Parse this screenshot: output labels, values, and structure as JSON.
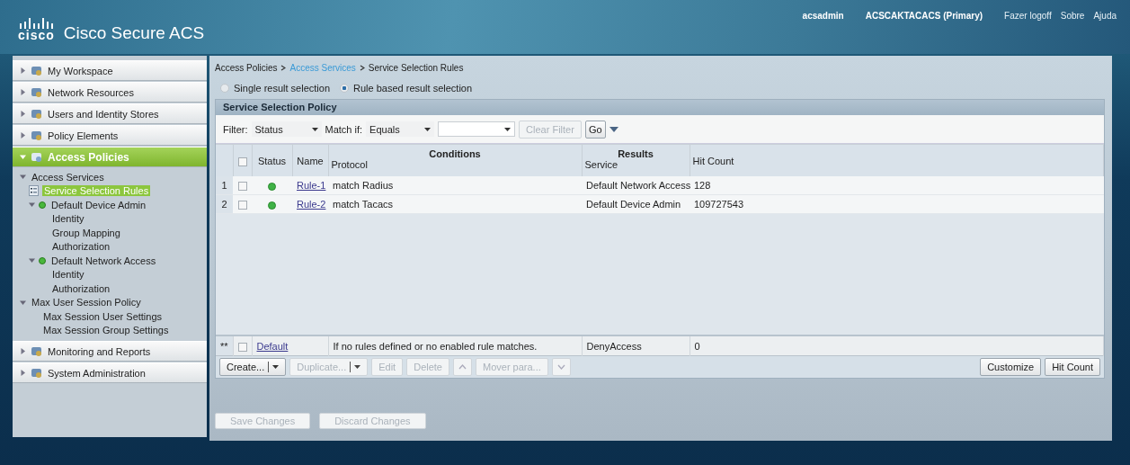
{
  "header": {
    "logo_text": "cisco",
    "product": "Cisco Secure ACS",
    "user": "acsadmin",
    "server": "ACSCAKTACACS (Primary)",
    "links": [
      "Fazer logoff",
      "Sobre",
      "Ajuda"
    ]
  },
  "sidebar": {
    "sections": [
      {
        "label": "My Workspace",
        "expanded": false,
        "selected": false
      },
      {
        "label": "Network Resources",
        "expanded": false,
        "selected": false
      },
      {
        "label": "Users and Identity Stores",
        "expanded": false,
        "selected": false
      },
      {
        "label": "Policy Elements",
        "expanded": false,
        "selected": false
      },
      {
        "label": "Access Policies",
        "expanded": true,
        "selected": true,
        "children": [
          {
            "label": "Access Services",
            "kind": "folder",
            "expanded": true,
            "selected": false,
            "children": [
              {
                "label": "Service Selection Rules",
                "kind": "page",
                "selected": true
              },
              {
                "label": "Default Device Admin",
                "kind": "service",
                "expanded": true,
                "selected": false,
                "children": [
                  {
                    "label": "Identity",
                    "kind": "leaf",
                    "selected": false
                  },
                  {
                    "label": "Group Mapping",
                    "kind": "leaf",
                    "selected": false
                  },
                  {
                    "label": "Authorization",
                    "kind": "leaf",
                    "selected": false
                  }
                ]
              },
              {
                "label": "Default Network Access",
                "kind": "service",
                "expanded": true,
                "selected": false,
                "children": [
                  {
                    "label": "Identity",
                    "kind": "leaf",
                    "selected": false
                  },
                  {
                    "label": "Authorization",
                    "kind": "leaf",
                    "selected": false
                  }
                ]
              }
            ]
          },
          {
            "label": "Max User Session Policy",
            "kind": "folder",
            "expanded": true,
            "selected": false,
            "children": [
              {
                "label": "Max Session User Settings",
                "kind": "leaf",
                "selected": false
              },
              {
                "label": "Max Session Group Settings",
                "kind": "leaf",
                "selected": false
              }
            ]
          }
        ]
      },
      {
        "label": "Monitoring and Reports",
        "expanded": false,
        "selected": false
      },
      {
        "label": "System Administration",
        "expanded": false,
        "selected": false
      }
    ]
  },
  "breadcrumb": [
    {
      "label": "Access Policies",
      "link": false
    },
    {
      "label": "Access Services",
      "link": true
    },
    {
      "label": "Service Selection Rules",
      "link": false
    }
  ],
  "radios": [
    {
      "label": "Single result selection",
      "selected": false
    },
    {
      "label": "Rule based result selection",
      "selected": true
    }
  ],
  "policy": {
    "title": "Service Selection Policy",
    "filter": {
      "label": "Filter:",
      "field": "Status",
      "match_label": "Match if:",
      "match": "Equals",
      "clear": "Clear Filter",
      "go": "Go"
    },
    "table": {
      "select_all": false,
      "headers": {
        "status": "Status",
        "name": "Name",
        "conditions": "Conditions",
        "protocol": "Protocol",
        "results": "Results",
        "service": "Service",
        "hit_count": "Hit Count"
      },
      "rows": [
        {
          "index": "1",
          "checked": false,
          "enabled": true,
          "name": "Rule-1",
          "protocol": "match Radius",
          "service": "Default Network Access",
          "hit_count": "128"
        },
        {
          "index": "2",
          "checked": false,
          "enabled": true,
          "name": "Rule-2",
          "protocol": "match Tacacs",
          "service": "Default Device Admin",
          "hit_count": "109727543"
        }
      ],
      "default_row": {
        "index": "**",
        "checked": false,
        "name": "Default",
        "condition": "If no rules defined or no enabled rule matches.",
        "service": "DenyAccess",
        "hit_count": "0"
      }
    },
    "toolbar": [
      {
        "kind": "split",
        "label": "Create...",
        "disabled": false
      },
      {
        "kind": "split",
        "label": "Duplicate...",
        "disabled": true
      },
      {
        "kind": "plain",
        "label": "Edit",
        "disabled": true
      },
      {
        "kind": "plain",
        "label": "Delete",
        "disabled": true
      },
      {
        "kind": "up",
        "disabled": true
      },
      {
        "kind": "plain",
        "label": "Mover para...",
        "disabled": true
      },
      {
        "kind": "down",
        "disabled": true
      }
    ],
    "right_buttons": [
      "Customize",
      "Hit Count"
    ]
  },
  "footer_buttons": [
    {
      "label": "Save Changes",
      "disabled": true
    },
    {
      "label": "Discard Changes",
      "disabled": true
    }
  ]
}
